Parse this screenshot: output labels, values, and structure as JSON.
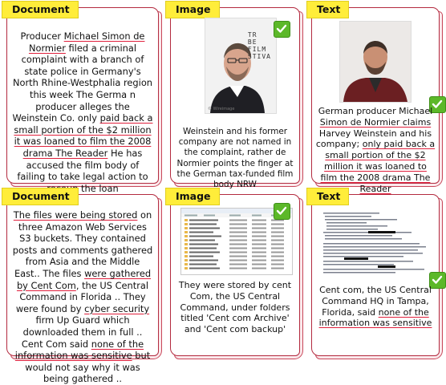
{
  "row1": {
    "document": {
      "label": "Document",
      "l1": "Producer ",
      "u1": "Michael Simon de Normier",
      "l2": " filed a criminal complaint with a branch of state police in Germany's North Rhine-Westphalia region this week The Germa n producer alleges the Weinstein Co. only ",
      "u2": "paid back a small portion of the $2 million it was loaned to film the 2008 drama The Reader",
      "l3": " He has accused the film body of failing to take legal action to recoup the loan"
    },
    "image": {
      "label": "Image",
      "photo_text": "TR\nBE\nFILM\nSTIVA",
      "watermark": "© Wireimage",
      "caption": "Weinstein and his former company are not named in the complaint, rather de Normier points the finger at the German tax-funded film body NRW"
    },
    "text": {
      "label": "Text",
      "l1": "German producer Michael ",
      "u1": "Simon de Normier claims",
      "l2": " Harvey Weinstein and his company; ",
      "u2": "only paid back a small portion of the $2 million it was loaned to film the 2008 drama The Reader"
    }
  },
  "row2": {
    "document": {
      "label": "Document",
      "u1": "The files were being stored",
      "l1": " on three Amazon Web Services S3 buckets. They contained posts and comments gathered from Asia and the Middle East.. The files ",
      "u2": "were gathered by Cent Com",
      "l2": ", the US Central Command in Florida .. They were found by ",
      "u3": "cyber security",
      "l3": " firm Up Guard which downloaded them in full .. Cent Com said ",
      "u4": "none of the information was sensitive",
      "l4": " but would not say why it was being gathered .."
    },
    "image": {
      "label": "Image",
      "caption": "They were stored by cent Com, the US Central Command, under folders titled 'Cent com Archive' and 'Cent com backup'"
    },
    "text": {
      "label": "Text",
      "l1": "Cent com, the US Central Command HQ in Tampa, Florida, said ",
      "u1": "none of the information was sensitive"
    }
  },
  "colors": {
    "frame": "#b32a3f",
    "tag": "#ffed3a",
    "check": "#5cb829",
    "underline": "#e0203c"
  },
  "icons": [
    "check-icon"
  ]
}
